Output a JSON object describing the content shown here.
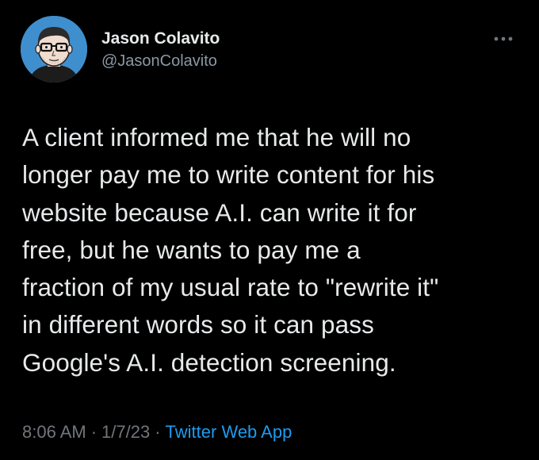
{
  "author": {
    "display_name": "Jason Colavito",
    "handle": "@JasonColavito",
    "avatar_icon": "cartoon-portrait-avatar",
    "avatar_bg": "#3f8fcf"
  },
  "tweet": {
    "text": "A client informed me that he will no\nlonger pay me to write content for his\nwebsite because A.I. can write it for\nfree, but he wants to pay me a\nfraction of my usual rate to \"rewrite it\"\nin different words so it can pass\nGoogle's A.I. detection screening.",
    "time": "8:06 AM",
    "date": "1/7/23",
    "separator": "·",
    "source": "Twitter Web App"
  },
  "icons": {
    "more": "more-options-icon"
  },
  "colors": {
    "background": "#000000",
    "text": "#e7e9ea",
    "secondary": "#71767b",
    "link": "#1d9bf0"
  }
}
